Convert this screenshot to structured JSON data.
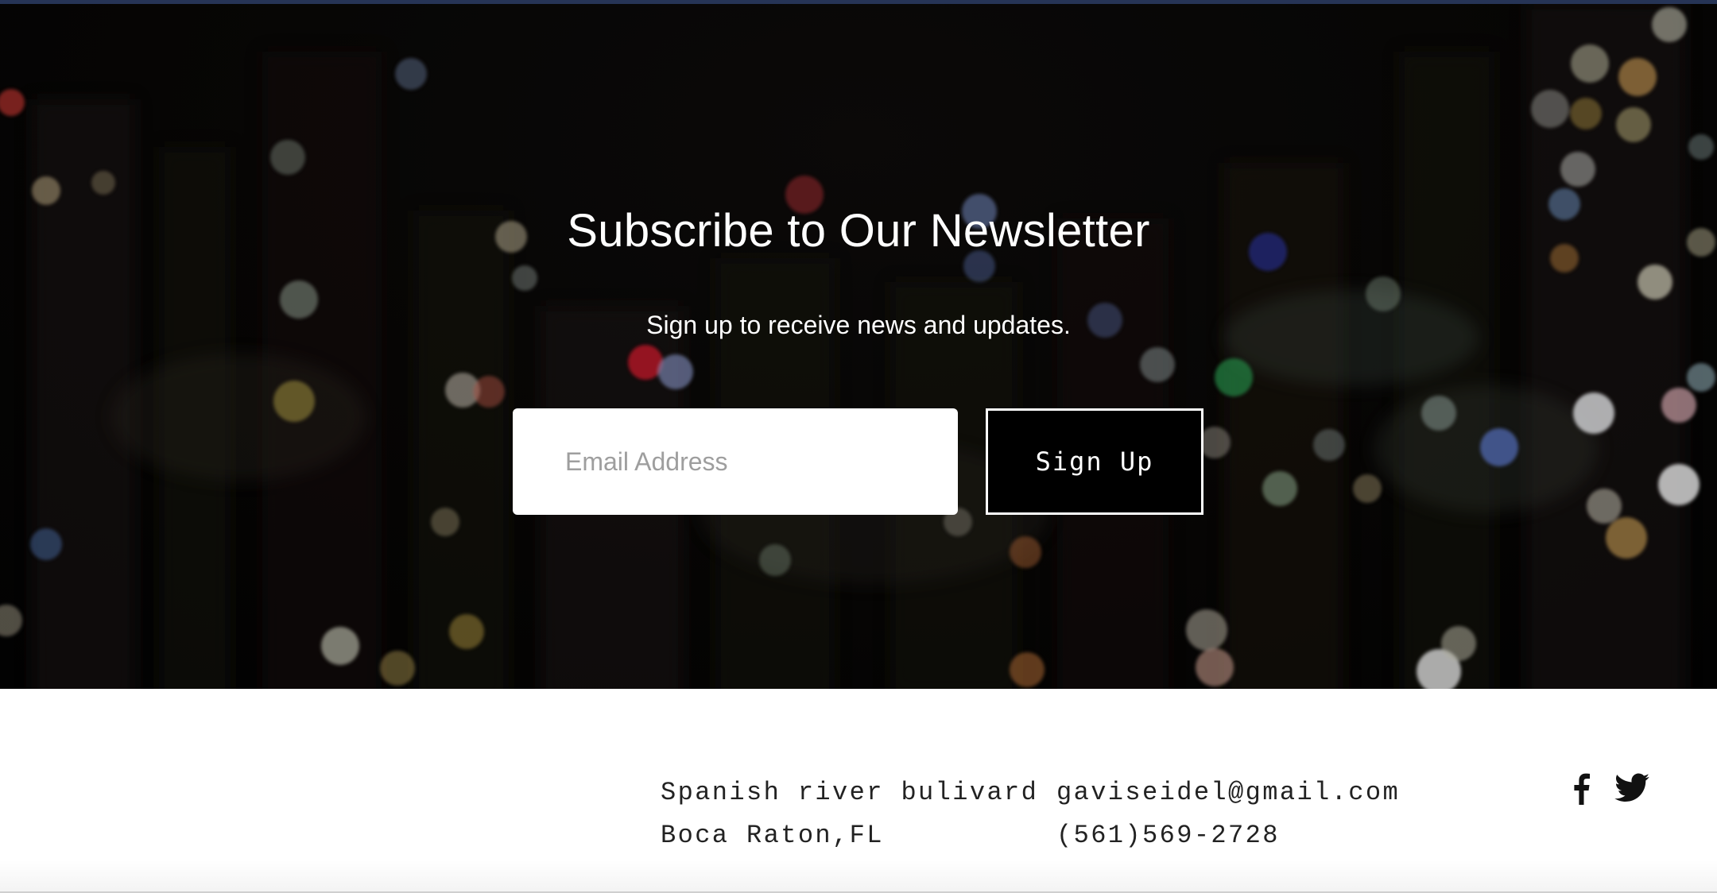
{
  "newsletter": {
    "title": "Subscribe to Our Newsletter",
    "subtitle": "Sign up to receive news and updates.",
    "email_placeholder": "Email Address",
    "signup_label": "Sign Up"
  },
  "footer": {
    "address_line1": "Spanish river bulivard",
    "address_line2": "Boca Raton,FL",
    "email": "gaviseidel@gmail.com",
    "phone": "(561)569-2728",
    "social_icons": [
      "facebook-icon",
      "twitter-icon"
    ]
  },
  "colors": {
    "top_strip": "#263456",
    "hero_background": "#070605",
    "button_background": "#000000",
    "text_light": "#ffffff",
    "text_dark": "#222222"
  }
}
